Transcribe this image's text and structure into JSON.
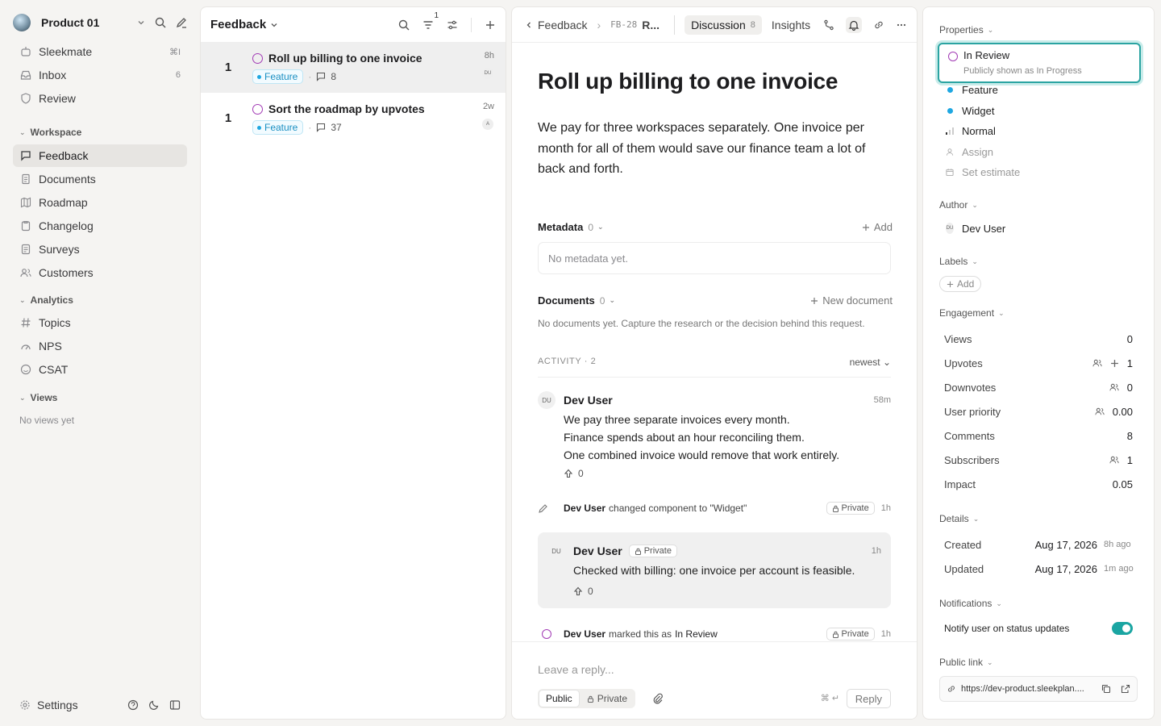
{
  "sidebar": {
    "workspace_name": "Product 01",
    "top_items": [
      {
        "label": "Sleekmate",
        "meta": "⌘I"
      },
      {
        "label": "Inbox",
        "meta": "6"
      },
      {
        "label": "Review",
        "meta": ""
      }
    ],
    "workspace_section": "Workspace",
    "workspace_items": [
      "Feedback",
      "Documents",
      "Roadmap",
      "Changelog",
      "Surveys",
      "Customers"
    ],
    "analytics_section": "Analytics",
    "analytics_items": [
      "Topics",
      "NPS",
      "CSAT"
    ],
    "views_section": "Views",
    "no_views": "No views yet",
    "settings": "Settings"
  },
  "list": {
    "title": "Feedback",
    "filter_count": "1",
    "rows": [
      {
        "votes": "1",
        "title": "Roll up billing to one invoice",
        "tag": "Feature",
        "comments": "8",
        "time": "8h",
        "avatar": "DU"
      },
      {
        "votes": "1",
        "title": "Sort the roadmap by upvotes",
        "tag": "Feature",
        "comments": "37",
        "time": "2w",
        "avatar": "A"
      }
    ]
  },
  "detail": {
    "breadcrumb_parent": "Feedback",
    "breadcrumb_id": "FB-28",
    "breadcrumb_title": "R...",
    "tab_discussion": "Discussion",
    "tab_discussion_count": "8",
    "tab_insights": "Insights",
    "title": "Roll up billing to one invoice",
    "body": "We pay for three workspaces separately. One invoice per month for all of them would save our finance team a lot of back and forth.",
    "metadata_label": "Metadata",
    "metadata_count": "0",
    "metadata_add": "Add",
    "metadata_empty": "No metadata yet.",
    "documents_label": "Documents",
    "documents_count": "0",
    "documents_new": "New document",
    "documents_empty": "No documents yet. Capture the research or the decision behind this request.",
    "activity_label": "ACTIVITY · 2",
    "activity_sort": "newest",
    "comment1": {
      "avatar": "DU",
      "author": "Dev User",
      "time": "58m",
      "lines": [
        "We pay three separate invoices every month.",
        "Finance spends about an hour reconciling them.",
        "One combined invoice would remove that work entirely."
      ],
      "upvotes": "0"
    },
    "event1": {
      "author": "Dev User",
      "text": "changed component to \"Widget\"",
      "badge": "Private",
      "time": "1h"
    },
    "note": {
      "avatar": "DU",
      "author": "Dev User",
      "badge": "Private",
      "time": "1h",
      "text": "Checked with billing: one invoice per account is feasible.",
      "upvotes": "0"
    },
    "event2": {
      "author": "Dev User",
      "text_before": "marked this as",
      "status": "In Review",
      "badge": "Private",
      "time": "1h"
    },
    "reply_placeholder": "Leave a reply...",
    "visibility_public": "Public",
    "visibility_private": "Private",
    "shortcut": "⌘ ↵",
    "reply_button": "Reply"
  },
  "props": {
    "properties_label": "Properties",
    "status": "In Review",
    "status_sub": "Publicly shown as In Progress",
    "type": "Feature",
    "component": "Widget",
    "priority": "Normal",
    "assign": "Assign",
    "estimate": "Set estimate",
    "author_label": "Author",
    "author_avatar": "DU",
    "author_name": "Dev User",
    "labels_label": "Labels",
    "labels_add": "Add",
    "engagement_label": "Engagement",
    "engagement": [
      {
        "label": "Views",
        "value": "0"
      },
      {
        "label": "Upvotes",
        "value": "1"
      },
      {
        "label": "Downvotes",
        "value": "0"
      },
      {
        "label": "User priority",
        "value": "0.00"
      },
      {
        "label": "Comments",
        "value": "8"
      },
      {
        "label": "Subscribers",
        "value": "1"
      },
      {
        "label": "Impact",
        "value": "0.05"
      }
    ],
    "details_label": "Details",
    "created_label": "Created",
    "created_date": "Aug 17, 2026",
    "created_ago": "8h ago",
    "updated_label": "Updated",
    "updated_date": "Aug 17, 2026",
    "updated_ago": "1m ago",
    "notifications_label": "Notifications",
    "notify_label": "Notify user on status updates",
    "notify_on": true,
    "public_link_label": "Public link",
    "public_link": "https://dev-product.sleekplan...."
  },
  "colors": {
    "accent": "#1aa5a2",
    "status_purple": "#a23bb5",
    "tag_blue": "#1ea7e1"
  }
}
